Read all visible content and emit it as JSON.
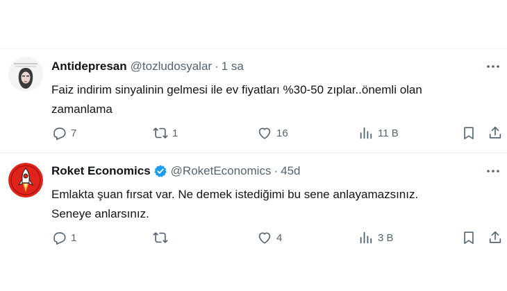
{
  "tweets": [
    {
      "name": "Antidepresan",
      "handle": "@tozludosyalar",
      "separator": "·",
      "time": "1 sa",
      "text_line1": "Faiz indirim sinyalinin gelmesi ile ev fiyatları %30-50 zıplar..önemli olan",
      "text_line2": "zamanlama",
      "verified": false,
      "actions": {
        "replies": "7",
        "reposts": "1",
        "likes": "16",
        "views": "11 B"
      }
    },
    {
      "name": "Roket Economics",
      "handle": "@RoketEconomics",
      "separator": "·",
      "time": "45d",
      "text_line1": "Emlakta şuan fırsat var. Ne demek istediğimi bu sene anlayamazsınız.",
      "text_line2": "Seneye anlarsınız.",
      "verified": true,
      "actions": {
        "replies": "1",
        "reposts": "",
        "likes": "4",
        "views": "3 B"
      }
    }
  ],
  "icons": {
    "more": "more-horizontal-icon",
    "reply": "reply-icon",
    "repost": "repost-icon",
    "like": "heart-icon",
    "views": "views-icon",
    "bookmark": "bookmark-icon",
    "share": "share-icon",
    "verified": "verified-badge-icon"
  },
  "colors": {
    "text": "#0f1419",
    "secondary": "#536471",
    "verified": "#1d9bf0",
    "divider": "#eff3f4",
    "rocket_bg": "#e0241b"
  }
}
